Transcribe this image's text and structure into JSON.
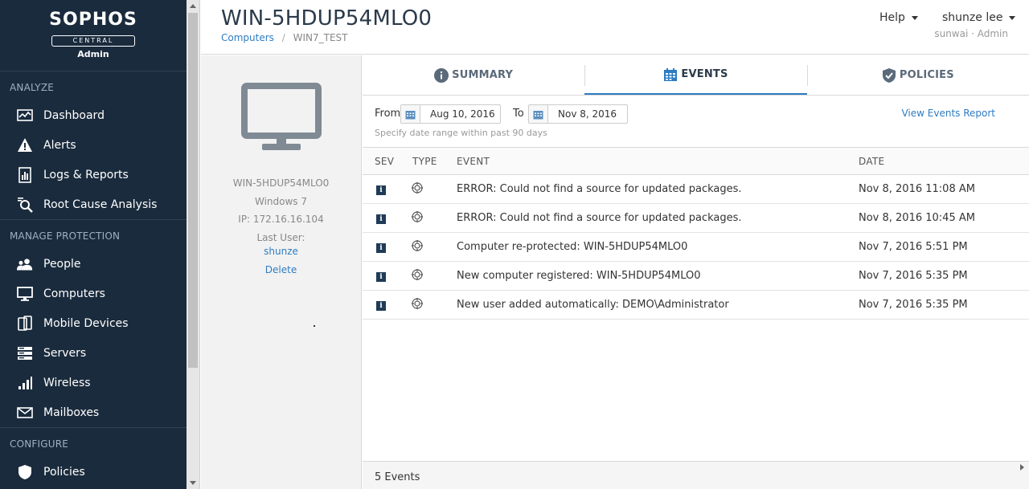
{
  "sidebar": {
    "logo": {
      "main": "SOPHOS",
      "sub": "CENTRAL",
      "role": "Admin"
    },
    "sections": [
      {
        "heading": "ANALYZE",
        "items": [
          {
            "label": "Dashboard",
            "icon": "dashboard-icon"
          },
          {
            "label": "Alerts",
            "icon": "alert-icon"
          },
          {
            "label": "Logs & Reports",
            "icon": "reports-icon"
          },
          {
            "label": "Root Cause Analysis",
            "icon": "magnifier-icon"
          }
        ]
      },
      {
        "heading": "MANAGE PROTECTION",
        "items": [
          {
            "label": "People",
            "icon": "people-icon"
          },
          {
            "label": "Computers",
            "icon": "computer-icon"
          },
          {
            "label": "Mobile Devices",
            "icon": "mobile-icon"
          },
          {
            "label": "Servers",
            "icon": "server-icon"
          },
          {
            "label": "Wireless",
            "icon": "wireless-icon"
          },
          {
            "label": "Mailboxes",
            "icon": "mail-icon"
          }
        ]
      },
      {
        "heading": "CONFIGURE",
        "items": [
          {
            "label": "Policies",
            "icon": "policy-icon"
          }
        ]
      }
    ]
  },
  "header": {
    "title": "WIN-5HDUP54MLO0",
    "breadcrumb": [
      "Computers",
      "WIN7_TEST"
    ],
    "help": "Help",
    "user_name": "shunze lee",
    "user_sub": "sunwai · Admin"
  },
  "detail": {
    "name": "WIN-5HDUP54MLO0",
    "os": "Windows 7",
    "ip": "IP: 172.16.16.104",
    "last_user_label": "Last User:",
    "last_user": "shunze",
    "delete": "Delete"
  },
  "tabs": [
    {
      "label": "SUMMARY",
      "icon": "info-circle-icon"
    },
    {
      "label": "EVENTS",
      "icon": "calendar-icon"
    },
    {
      "label": "POLICIES",
      "icon": "shield-icon"
    }
  ],
  "filter": {
    "from_label": "From",
    "from_value": "Aug 10, 2016",
    "to_label": "To",
    "to_value": "Nov 8, 2016",
    "hint": "Specify date range within past 90 days",
    "report_link": "View Events Report"
  },
  "table": {
    "headers": {
      "sev": "SEV",
      "type": "TYPE",
      "event": "EVENT",
      "date": "DATE"
    },
    "rows": [
      {
        "sev": "i",
        "event": "ERROR: Could not find a source for updated packages.",
        "date": "Nov 8, 2016 11:08 AM"
      },
      {
        "sev": "i",
        "event": "ERROR: Could not find a source for updated packages.",
        "date": "Nov 8, 2016 10:45 AM"
      },
      {
        "sev": "i",
        "event": "Computer re-protected: WIN-5HDUP54MLO0",
        "date": "Nov 7, 2016 5:51 PM"
      },
      {
        "sev": "i",
        "event": "New computer registered:  WIN-5HDUP54MLO0",
        "date": "Nov 7, 2016 5:35 PM"
      },
      {
        "sev": "i",
        "event": "New user added automatically: DEMO\\Administrator",
        "date": "Nov 7, 2016 5:35 PM"
      }
    ]
  },
  "footer": {
    "count": "5 Events"
  },
  "colors": {
    "sidebar": "#1a2b3d",
    "accent": "#2e7cc2",
    "severity": "#1f3b57"
  }
}
